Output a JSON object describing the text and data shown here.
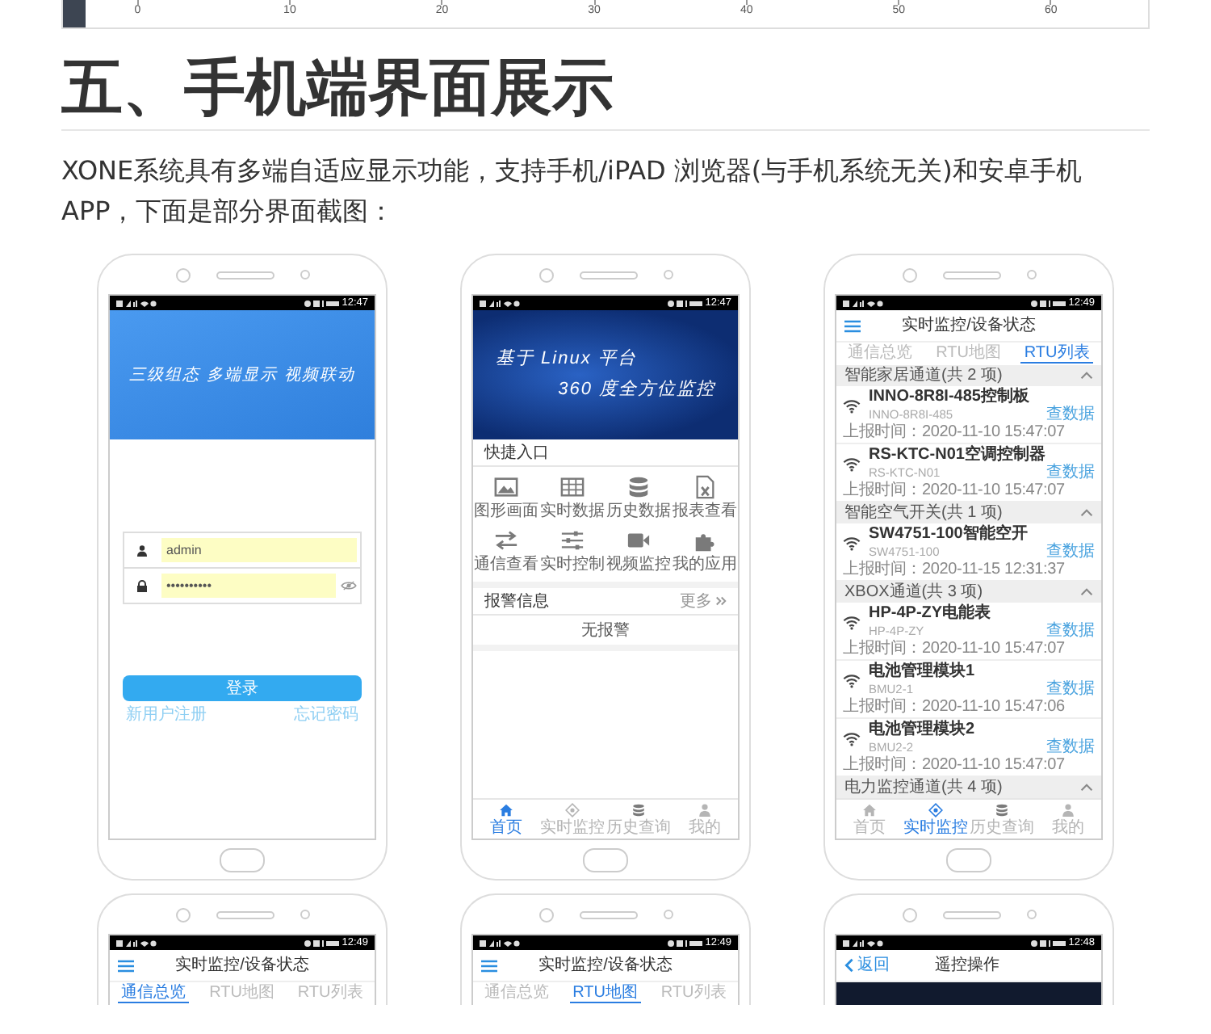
{
  "chart_strip": {
    "x_ticks": [
      "0",
      "10",
      "20",
      "30",
      "40",
      "50",
      "60"
    ]
  },
  "heading": "五、手机端界面展示",
  "intro": "XONE系统具有多端自适应显示功能，支持手机/iPAD 浏览器(与手机系统无关)和安卓手机APP，下面是部分界面截图：",
  "phones": [
    {
      "kind": "login",
      "status_time": "12:47",
      "banner_text": "三级组态 多端显示 视频联动",
      "username": "admin",
      "password": "••••••••••",
      "login_button": "登录",
      "register_link": "新用户注册",
      "forgot_link": "忘记密码"
    },
    {
      "kind": "home",
      "status_time": "12:47",
      "banner_lines": [
        "基于 Linux 平台",
        "360 度全方位监控"
      ],
      "quick_title": "快捷入口",
      "shortcuts": [
        {
          "label": "图形画面"
        },
        {
          "label": "实时数据"
        },
        {
          "label": "历史数据"
        },
        {
          "label": "报表查看"
        },
        {
          "label": "通信查看"
        },
        {
          "label": "实时控制"
        },
        {
          "label": "视频监控"
        },
        {
          "label": "我的应用"
        }
      ],
      "alarm_title": "报警信息",
      "more_link": "更多",
      "alarm_empty": "无报警",
      "nav": [
        {
          "label": "首页",
          "selected": true
        },
        {
          "label": "实时监控",
          "selected": false
        },
        {
          "label": "历史查询",
          "selected": false
        },
        {
          "label": "我的",
          "selected": false
        }
      ]
    },
    {
      "kind": "device_list",
      "status_time": "12:49",
      "title": "实时监控/设备状态",
      "tabs": [
        {
          "label": "通信总览",
          "selected": false
        },
        {
          "label": "RTU地图",
          "selected": false
        },
        {
          "label": "RTU列表",
          "selected": true
        }
      ],
      "groups": [
        {
          "title": "智能家居通道(共 2 项)",
          "expanded": true,
          "devices": [
            {
              "name": "INNO-8R8I-485控制板",
              "code": "INNO-8R8I-485",
              "report_time": "上报时间：2020-11-10 15:47:07",
              "link": "查数据"
            },
            {
              "name": "RS-KTC-N01空调控制器",
              "code": "RS-KTC-N01",
              "report_time": "上报时间：2020-11-10 15:47:07",
              "link": "查数据"
            }
          ]
        },
        {
          "title": "智能空气开关(共 1 项)",
          "expanded": true,
          "devices": [
            {
              "name": "SW4751-100智能空开",
              "code": "SW4751-100",
              "report_time": "上报时间：2020-11-15 12:31:37",
              "link": "查数据"
            }
          ]
        },
        {
          "title": "XBOX通道(共 3 项)",
          "expanded": true,
          "devices": [
            {
              "name": "HP-4P-ZY电能表",
              "code": "HP-4P-ZY",
              "report_time": "上报时间：2020-11-10 15:47:07",
              "link": "查数据"
            },
            {
              "name": "电池管理模块1",
              "code": "BMU2-1",
              "report_time": "上报时间：2020-11-10 15:47:06",
              "link": "查数据"
            },
            {
              "name": "电池管理模块2",
              "code": "BMU2-2",
              "report_time": "上报时间：2020-11-10 15:47:07",
              "link": "查数据"
            }
          ]
        },
        {
          "title": "电力监控通道(共 4 项)",
          "expanded": true
        }
      ],
      "nav": [
        {
          "label": "首页",
          "selected": false
        },
        {
          "label": "实时监控",
          "selected": true
        },
        {
          "label": "历史查询",
          "selected": false
        },
        {
          "label": "我的",
          "selected": false
        }
      ]
    },
    {
      "kind": "status_tabs",
      "status_time": "12:49",
      "title": "实时监控/设备状态",
      "tabs": [
        {
          "label": "通信总览",
          "selected": true
        },
        {
          "label": "RTU地图",
          "selected": false
        },
        {
          "label": "RTU列表",
          "selected": false
        }
      ]
    },
    {
      "kind": "status_tabs",
      "status_time": "12:49",
      "title": "实时监控/设备状态",
      "tabs": [
        {
          "label": "通信总览",
          "selected": false
        },
        {
          "label": "RTU地图",
          "selected": true
        },
        {
          "label": "RTU列表",
          "selected": false
        }
      ]
    },
    {
      "kind": "remote",
      "status_time": "12:48",
      "back_label": "返回",
      "title": "遥控操作"
    }
  ]
}
